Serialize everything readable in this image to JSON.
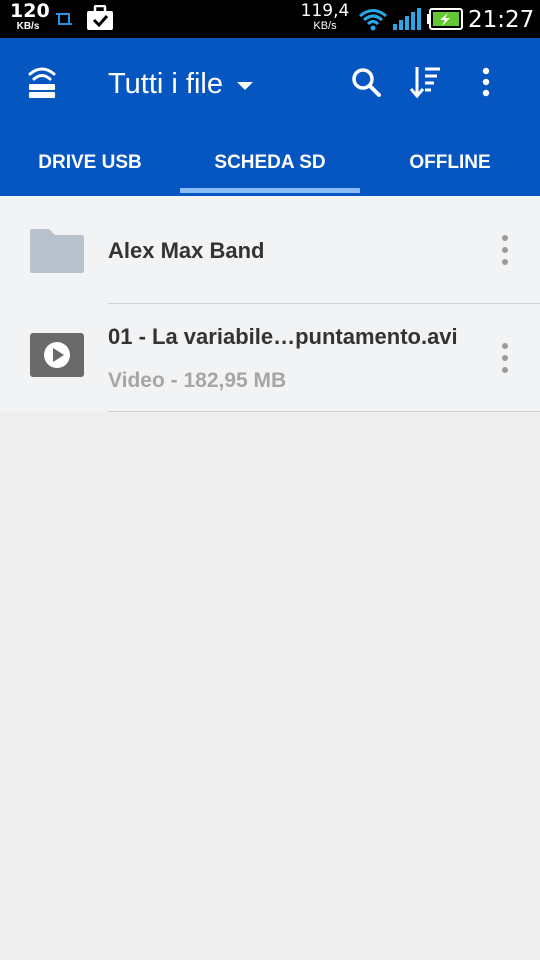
{
  "status_bar": {
    "net_speed_left": "120",
    "net_speed_left_unit": "KB/s",
    "net_speed_right": "119,4",
    "net_speed_right_unit": "KB/s",
    "time": "21:27",
    "icons": [
      "screenshot-icon",
      "work-profile-icon",
      "wifi-icon",
      "signal-icon",
      "battery-charging-icon"
    ]
  },
  "app_bar": {
    "title": "Tutti i file",
    "icons": [
      "wireless-drive-icon",
      "search-icon",
      "sort-icon",
      "overflow-menu-icon"
    ],
    "accent": "#0556c0"
  },
  "tabs": [
    {
      "label": "DRIVE USB",
      "selected": false
    },
    {
      "label": "SCHEDA SD",
      "selected": true
    },
    {
      "label": "OFFLINE",
      "selected": false
    }
  ],
  "files": [
    {
      "name": "Alex Max Band",
      "meta": "",
      "icon": "folder-icon"
    },
    {
      "name": "01 - La variabile…puntamento.avi",
      "meta": "Video - 182,95 MB",
      "icon": "video-file-icon"
    }
  ]
}
